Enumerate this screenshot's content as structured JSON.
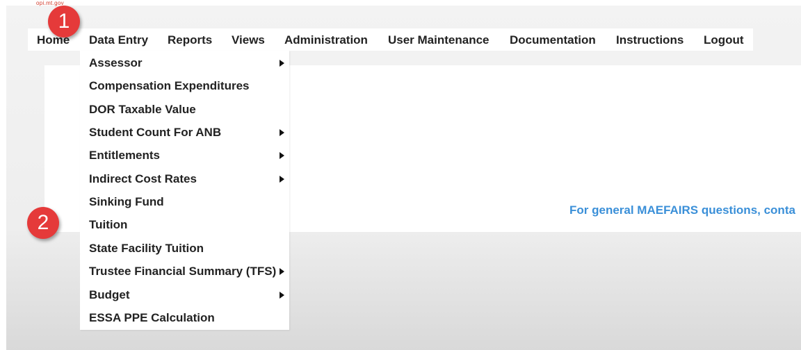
{
  "nav": {
    "items": [
      {
        "label": "Home"
      },
      {
        "label": "Data Entry"
      },
      {
        "label": "Reports"
      },
      {
        "label": "Views"
      },
      {
        "label": "Administration"
      },
      {
        "label": "User Maintenance"
      },
      {
        "label": "Documentation"
      },
      {
        "label": "Instructions"
      },
      {
        "label": "Logout"
      }
    ]
  },
  "data_entry_menu": {
    "items": [
      {
        "label": "Assessor",
        "has_submenu": true
      },
      {
        "label": "Compensation Expenditures",
        "has_submenu": false
      },
      {
        "label": "DOR Taxable Value",
        "has_submenu": false
      },
      {
        "label": "Student Count For ANB",
        "has_submenu": true
      },
      {
        "label": "Entitlements",
        "has_submenu": true
      },
      {
        "label": "Indirect Cost Rates",
        "has_submenu": true
      },
      {
        "label": "Sinking Fund",
        "has_submenu": false
      },
      {
        "label": "Tuition",
        "has_submenu": false
      },
      {
        "label": "State Facility Tuition",
        "has_submenu": false
      },
      {
        "label": "Trustee Financial Summary (TFS)",
        "has_submenu": true
      },
      {
        "label": "Budget",
        "has_submenu": true
      },
      {
        "label": "ESSA PPE Calculation",
        "has_submenu": false
      }
    ]
  },
  "main": {
    "contact_text": "For general MAEFAIRS questions, conta"
  },
  "callouts": {
    "one": "1",
    "two": "2"
  },
  "header": {
    "logo_fragment": "opi.mt.gov"
  },
  "colors": {
    "badge": "#e53a3a",
    "link": "#3a8fd8"
  }
}
